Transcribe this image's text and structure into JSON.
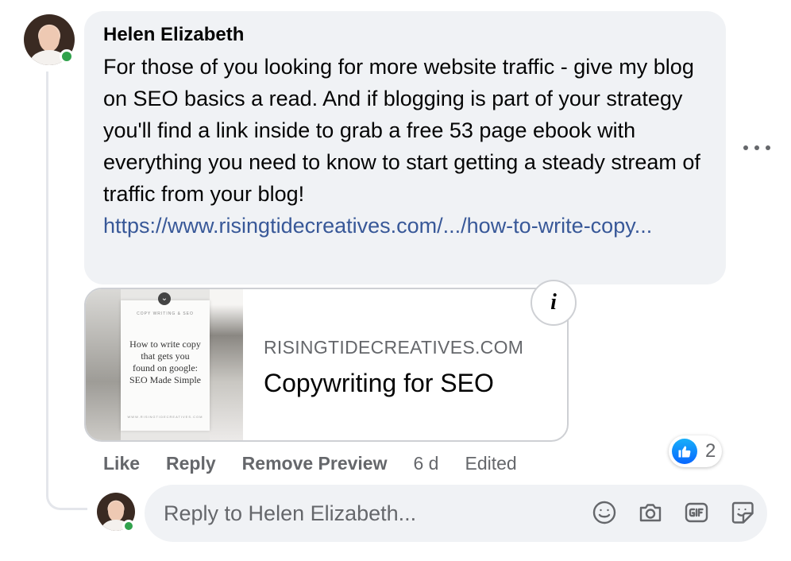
{
  "comment": {
    "author": "Helen Elizabeth",
    "text": "For those of you looking for more website traffic - give my blog on SEO basics a read. And if blogging is part of your strategy you'll find a link inside to grab a free 53 page ebook with everything you need to know to start getting a steady stream of traffic from your blog!",
    "link": "https://www.risingtidecreatives.com/.../how-to-write-copy..."
  },
  "preview": {
    "thumb_subtitle": "COPY WRITING & SEO",
    "thumb_title": "How to write copy that gets you found on google: SEO Made Simple",
    "thumb_footer": "WWW.RISINGTIDECREATIVES.COM",
    "domain": "RISINGTIDECREATIVES.COM",
    "title": "Copywriting for SEO"
  },
  "actions": {
    "like": "Like",
    "reply": "Reply",
    "remove_preview": "Remove Preview",
    "time": "6 d",
    "edited": "Edited"
  },
  "reactions": {
    "type": "like",
    "count": "2",
    "badge_color": "#0866ff"
  },
  "reply_box": {
    "placeholder": "Reply to Helen Elizabeth...",
    "icons": [
      "emoji-icon",
      "camera-icon",
      "gif-icon",
      "sticker-icon"
    ]
  },
  "colors": {
    "bubble_bg": "#f0f2f5",
    "link": "#385898",
    "secondary_text": "#65676b",
    "online": "#31a24c"
  }
}
